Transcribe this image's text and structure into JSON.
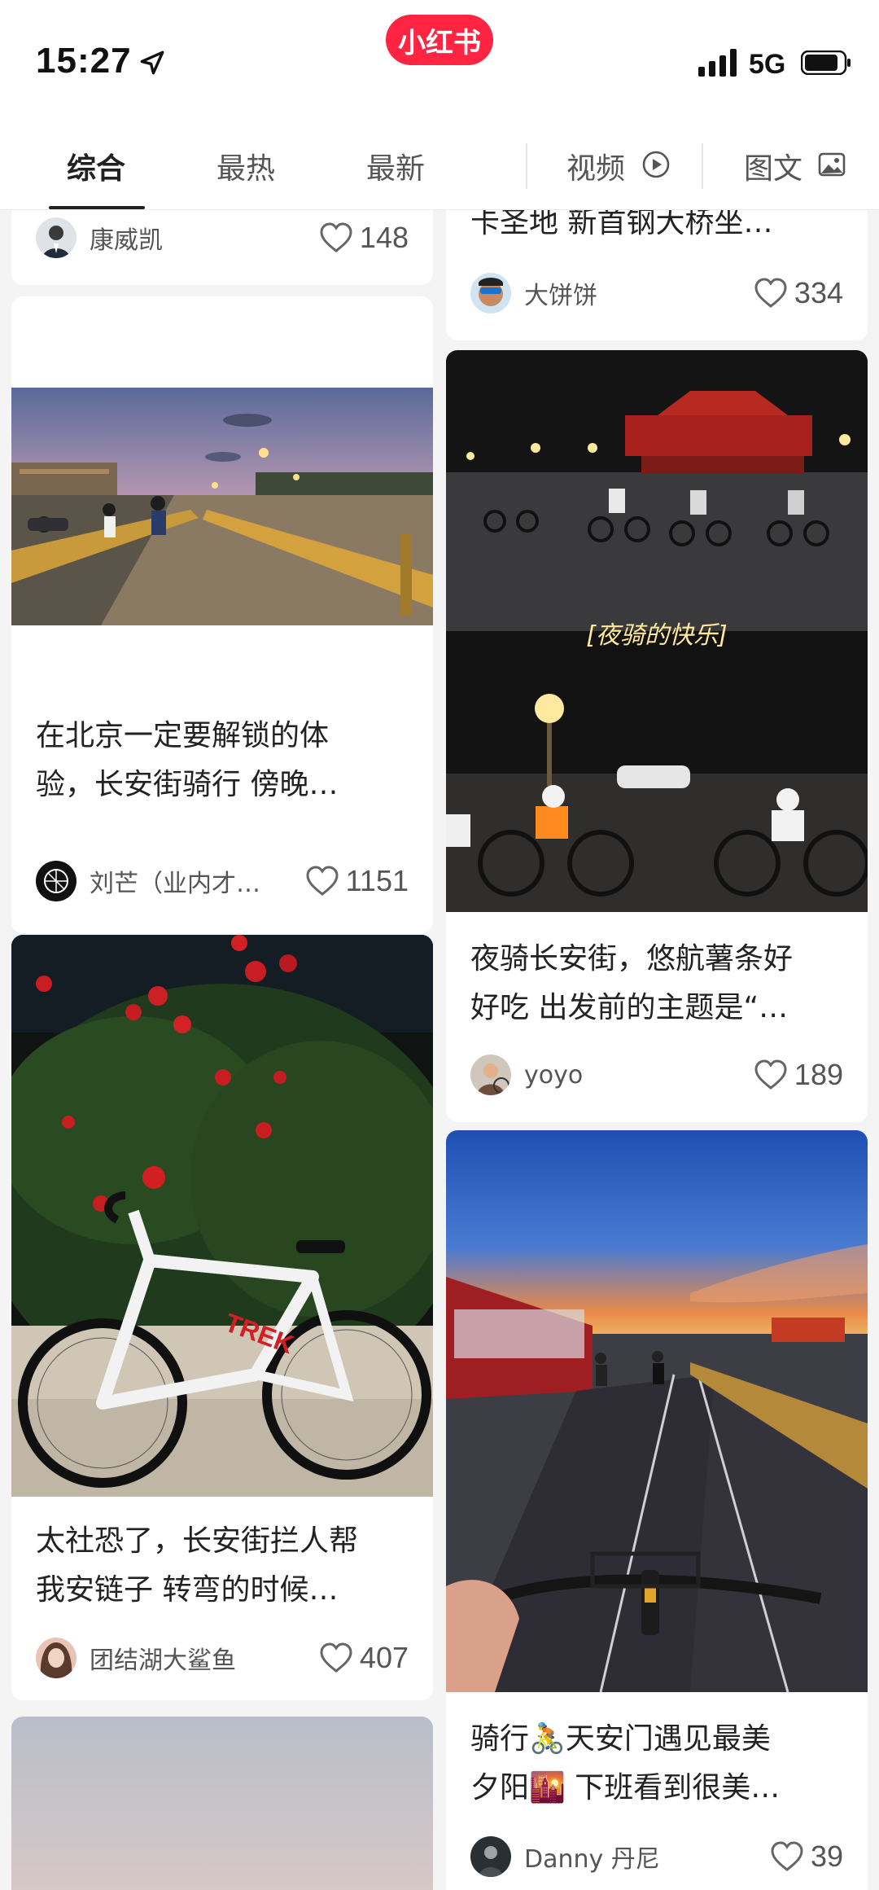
{
  "status": {
    "time": "15:27",
    "network": "5G"
  },
  "app": {
    "logo": "小红书",
    "brand_color": "#ff2442"
  },
  "tabs": [
    {
      "label": "综合",
      "active": true
    },
    {
      "label": "最热"
    },
    {
      "label": "最新"
    },
    {
      "label": "视频",
      "icon": "play-circle-icon"
    },
    {
      "label": "图文",
      "icon": "image-icon"
    }
  ],
  "feed": {
    "left": [
      {
        "title": "",
        "author": "康威凯",
        "likes": "148"
      },
      {
        "title_line1": "在北京一定要解锁的体",
        "title_line2": "验，长安街骑行 傍晚…",
        "author": "刘芒（业内才…",
        "likes": "1151"
      },
      {
        "title_line1": "太社恐了，长安街拦人帮",
        "title_line2": "我安链子 转弯的时候…",
        "author": "团结湖大鲨鱼",
        "likes": "407",
        "image_text": "TREK"
      },
      {
        "title": "",
        "author": "",
        "likes": ""
      }
    ],
    "right": [
      {
        "title_line2": "卡圣地 新首钢大桥坐…",
        "author": "大饼饼",
        "likes": "334"
      },
      {
        "image_caption": "[夜骑的快乐]",
        "title_line1": "夜骑长安街，悠航薯条好",
        "title_line2": "好吃 出发前的主题是“…",
        "author": "yoyo",
        "likes": "189"
      },
      {
        "title_line1": "骑行🚴天安门遇见最美",
        "title_line2": "夕阳🌇 下班看到很美…",
        "author": "Danny 丹尼",
        "likes": "39"
      }
    ]
  }
}
